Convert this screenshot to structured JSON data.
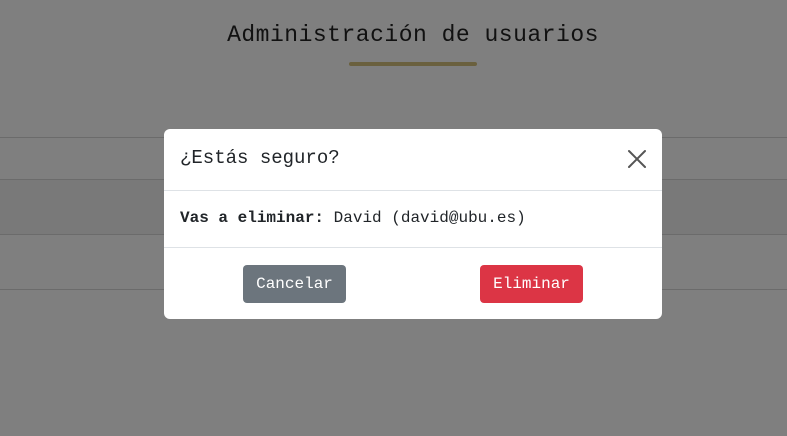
{
  "page": {
    "title": "Administración de usuarios"
  },
  "modal": {
    "title": "¿Estás seguro?",
    "body_label": "Vas a eliminar:",
    "body_value": "David (david@ubu.es)",
    "cancel_label": "Cancelar",
    "delete_label": "Eliminar",
    "close_icon": "close-icon"
  },
  "colors": {
    "accent_underline": "#d4c17d",
    "cancel_button": "#6c757d",
    "delete_button": "#dc3545"
  }
}
